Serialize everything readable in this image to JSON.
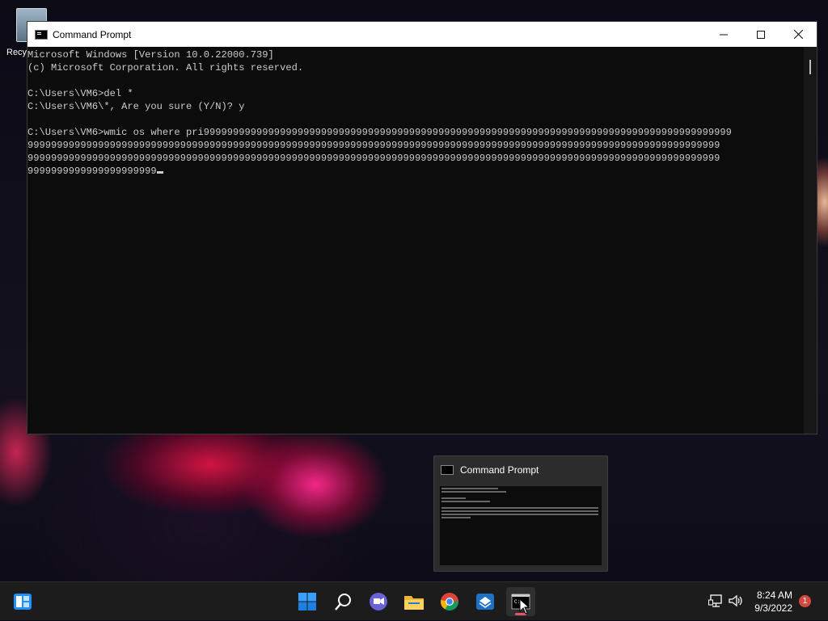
{
  "desktop": {
    "recycle_bin_label": "Recy"
  },
  "cmd_window": {
    "title": "Command Prompt",
    "minimize_symbol": "—",
    "maximize_symbol": "☐",
    "close_symbol": "✕",
    "lines": [
      "Microsoft Windows [Version 10.0.22000.739]",
      "(c) Microsoft Corporation. All rights reserved.",
      "",
      "C:\\Users\\VM6>del *",
      "C:\\Users\\VM6\\*, Are you sure (Y/N)? y",
      "",
      "C:\\Users\\VM6>wmic os where pri999999999999999999999999999999999999999999999999999999999999999999999999999999999999999999",
      "9999999999999999999999999999999999999999999999999999999999999999999999999999999999999999999999999999999999999999999999",
      "9999999999999999999999999999999999999999999999999999999999999999999999999999999999999999999999999999999999999999999999",
      "9999999999999999999999"
    ]
  },
  "taskbar_preview": {
    "title": "Command Prompt"
  },
  "taskbar": {
    "icons": [
      "widgets-icon",
      "start-icon",
      "search-icon",
      "teams-chat-icon",
      "file-explorer-icon",
      "chrome-icon",
      "store-icon",
      "command-prompt-icon"
    ],
    "time": "8:24 AM",
    "date": "9/3/2022",
    "notification_count": "1"
  },
  "colors": {
    "console_bg": "#0c0c0c",
    "console_text": "#cccccc",
    "taskbar_bg": "#1c1c1c",
    "accent_windows_blue": "#1e90ff",
    "notification_badge": "#d14a3f"
  }
}
